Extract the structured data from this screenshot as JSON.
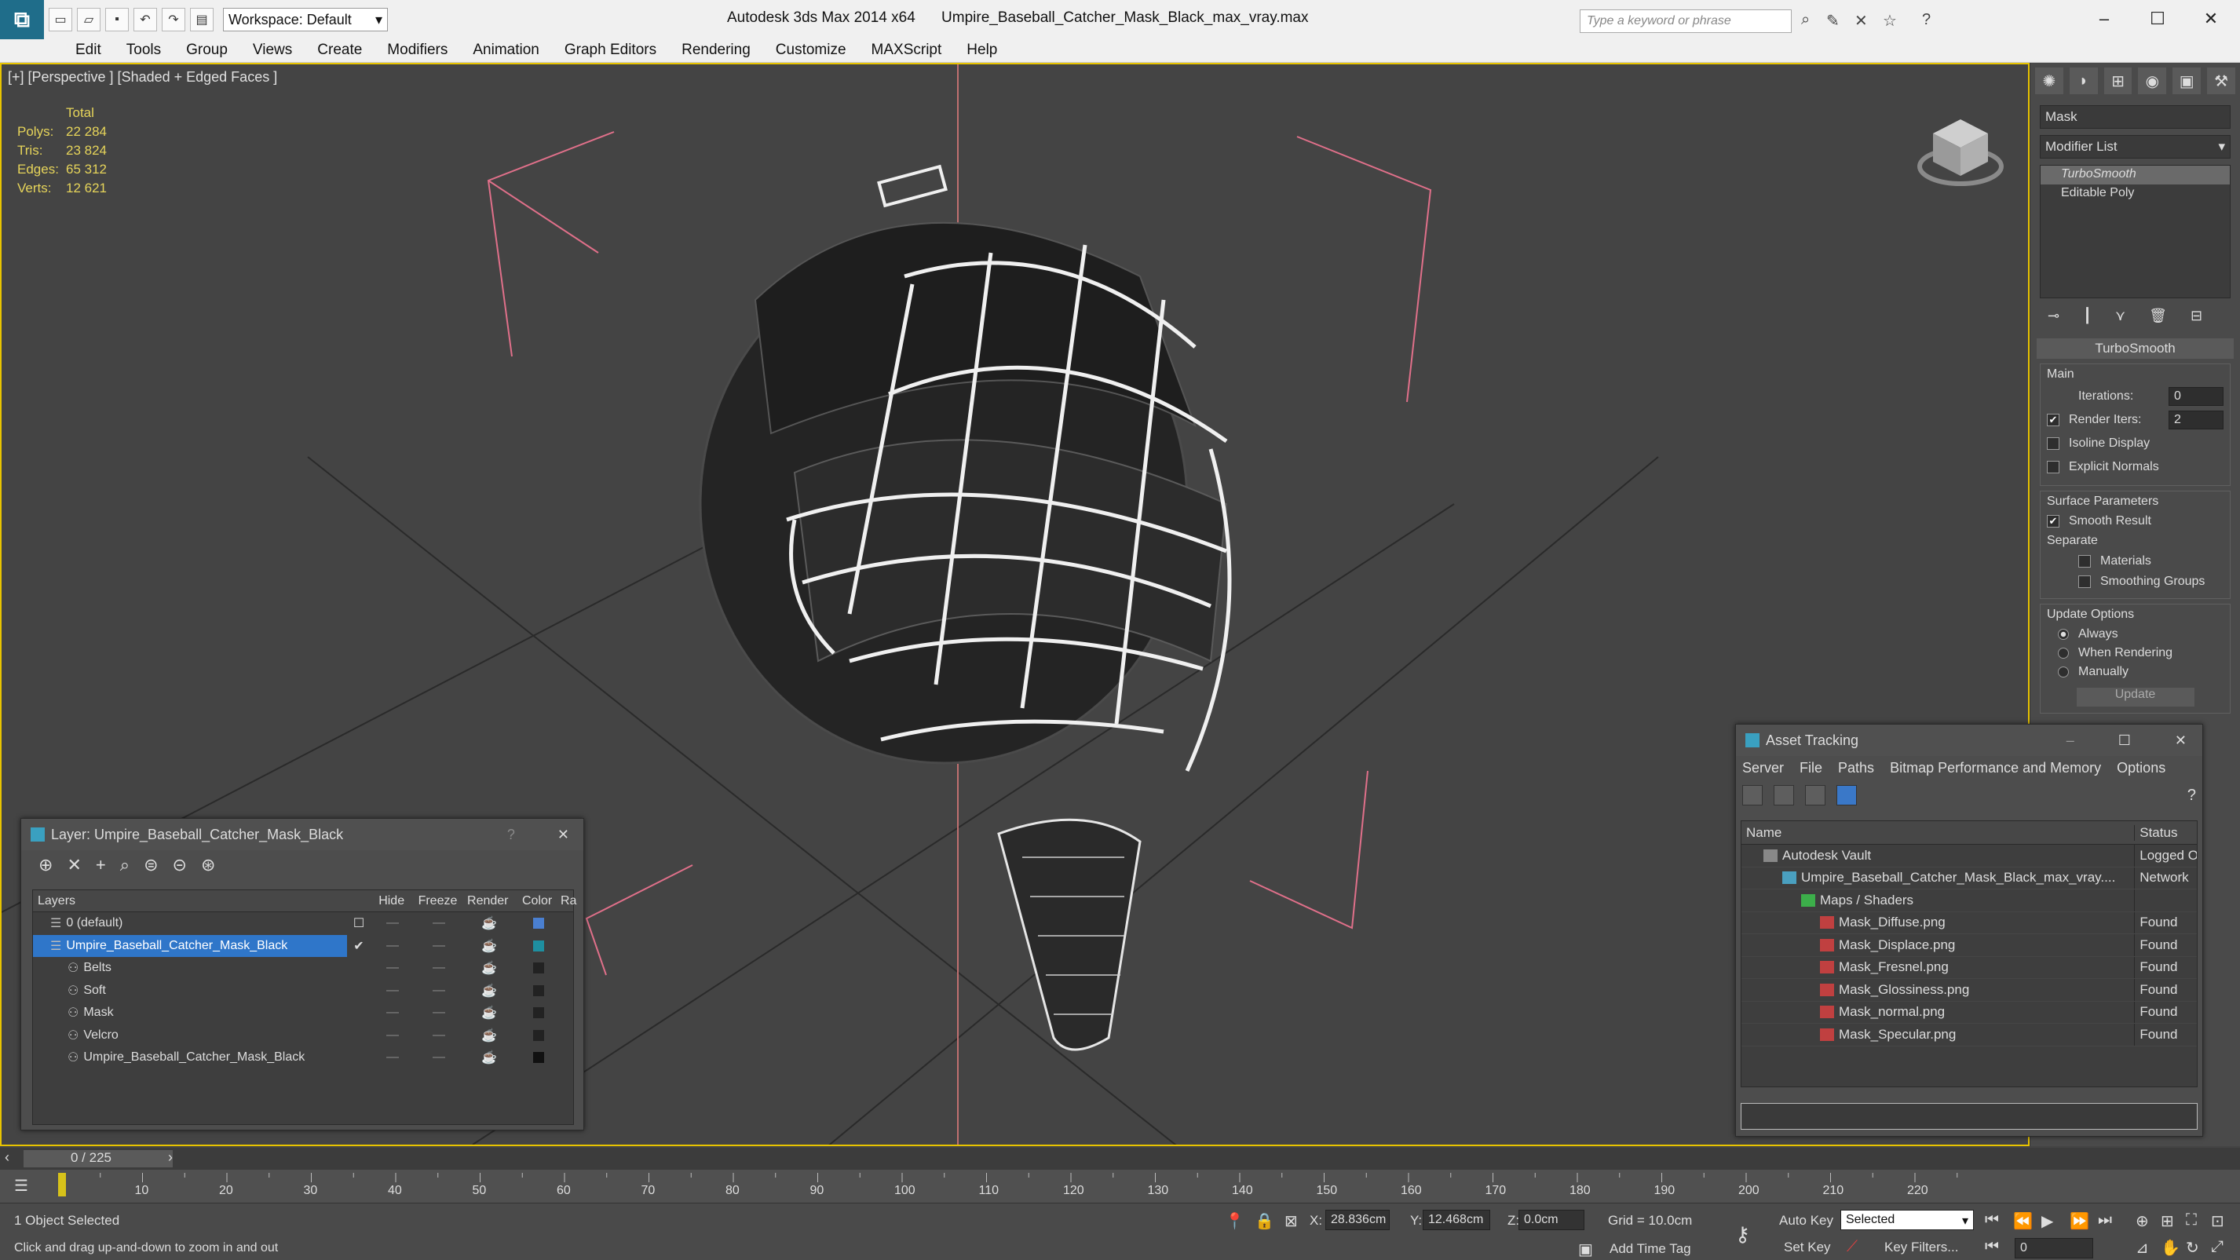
{
  "titlebar": {
    "workspace": "Workspace: Default",
    "app_title": "Autodesk 3ds Max  2014 x64",
    "file_name": "Umpire_Baseball_Catcher_Mask_Black_max_vray.max",
    "search_placeholder": "Type a keyword or phrase"
  },
  "menu": [
    "Edit",
    "Tools",
    "Group",
    "Views",
    "Create",
    "Modifiers",
    "Animation",
    "Graph Editors",
    "Rendering",
    "Customize",
    "MAXScript",
    "Help"
  ],
  "viewport": {
    "label": "[+] [Perspective ] [Shaded + Edged Faces ]",
    "stats": {
      "header": "Total",
      "rows": [
        {
          "label": "Polys:",
          "value": "22 284"
        },
        {
          "label": "Tris:",
          "value": "23 824"
        },
        {
          "label": "Edges:",
          "value": "65 312"
        },
        {
          "label": "Verts:",
          "value": "12 621"
        }
      ]
    }
  },
  "command_panel": {
    "object_name": "Mask",
    "modifier_list": "Modifier List",
    "stack": [
      "TurboSmooth",
      "Editable Poly"
    ],
    "rollout_title": "TurboSmooth",
    "main_group": "Main",
    "iterations_label": "Iterations:",
    "iterations_value": "0",
    "render_iters_label": "Render Iters:",
    "render_iters_value": "2",
    "isoline_label": "Isoline Display",
    "explicit_normals_label": "Explicit Normals",
    "surface_params": "Surface Parameters",
    "smooth_result": "Smooth Result",
    "separate": "Separate",
    "materials": "Materials",
    "smoothing_groups": "Smoothing Groups",
    "update_options": "Update Options",
    "always": "Always",
    "when_rendering": "When Rendering",
    "manually": "Manually",
    "update_btn": "Update"
  },
  "layer_dialog": {
    "title": "Layer: Umpire_Baseball_Catcher_Mask_Black",
    "help": "?",
    "columns": [
      "Layers",
      "Hide",
      "Freeze",
      "Render",
      "Color",
      "Ra"
    ],
    "rows": [
      {
        "name": "0 (default)",
        "color": "#4a7fd0"
      },
      {
        "name": "Umpire_Baseball_Catcher_Mask_Black",
        "color": "#1e8fa0"
      },
      {
        "name": "Belts",
        "color": "#222222"
      },
      {
        "name": "Soft",
        "color": "#222222"
      },
      {
        "name": "Mask",
        "color": "#222222"
      },
      {
        "name": "Velcro",
        "color": "#222222"
      },
      {
        "name": "Umpire_Baseball_Catcher_Mask_Black",
        "color": "#111111"
      }
    ]
  },
  "asset_dialog": {
    "title": "Asset Tracking",
    "menu": [
      "Server",
      "File",
      "Paths",
      "Bitmap Performance and Memory",
      "Options"
    ],
    "col_name": "Name",
    "col_status": "Status",
    "rows": [
      {
        "name": "Autodesk Vault",
        "status": "Logged O",
        "indent": 0,
        "icon": "vault"
      },
      {
        "name": "Umpire_Baseball_Catcher_Mask_Black_max_vray....",
        "status": "Network",
        "indent": 1,
        "icon": "max"
      },
      {
        "name": "Maps / Shaders",
        "status": "",
        "indent": 2,
        "icon": "maps"
      },
      {
        "name": "Mask_Diffuse.png",
        "status": "Found",
        "indent": 3,
        "icon": "png"
      },
      {
        "name": "Mask_Displace.png",
        "status": "Found",
        "indent": 3,
        "icon": "png"
      },
      {
        "name": "Mask_Fresnel.png",
        "status": "Found",
        "indent": 3,
        "icon": "png"
      },
      {
        "name": "Mask_Glossiness.png",
        "status": "Found",
        "indent": 3,
        "icon": "png"
      },
      {
        "name": "Mask_normal.png",
        "status": "Found",
        "indent": 3,
        "icon": "png"
      },
      {
        "name": "Mask_Specular.png",
        "status": "Found",
        "indent": 3,
        "icon": "png"
      }
    ]
  },
  "timeline": {
    "frame_label": "0 / 225",
    "ticks": [
      "10",
      "20",
      "30",
      "40",
      "50",
      "60",
      "70",
      "80",
      "90",
      "100",
      "110",
      "120",
      "130",
      "140",
      "150",
      "160",
      "170",
      "180",
      "190",
      "200",
      "210",
      "220"
    ]
  },
  "status": {
    "selected": "1 Object Selected",
    "prompt": "Click and drag up-and-down to zoom in and out",
    "x_label": "X:",
    "x_value": "28.836cm",
    "y_label": "Y:",
    "y_value": "12.468cm",
    "z_label": "Z:",
    "z_value": "0.0cm",
    "grid": "Grid = 10.0cm",
    "add_time_tag": "Add Time Tag",
    "auto_key": "Auto Key",
    "set_key": "Set Key",
    "selected_option": "Selected",
    "key_filters": "Key Filters...",
    "frame_value": "0"
  }
}
